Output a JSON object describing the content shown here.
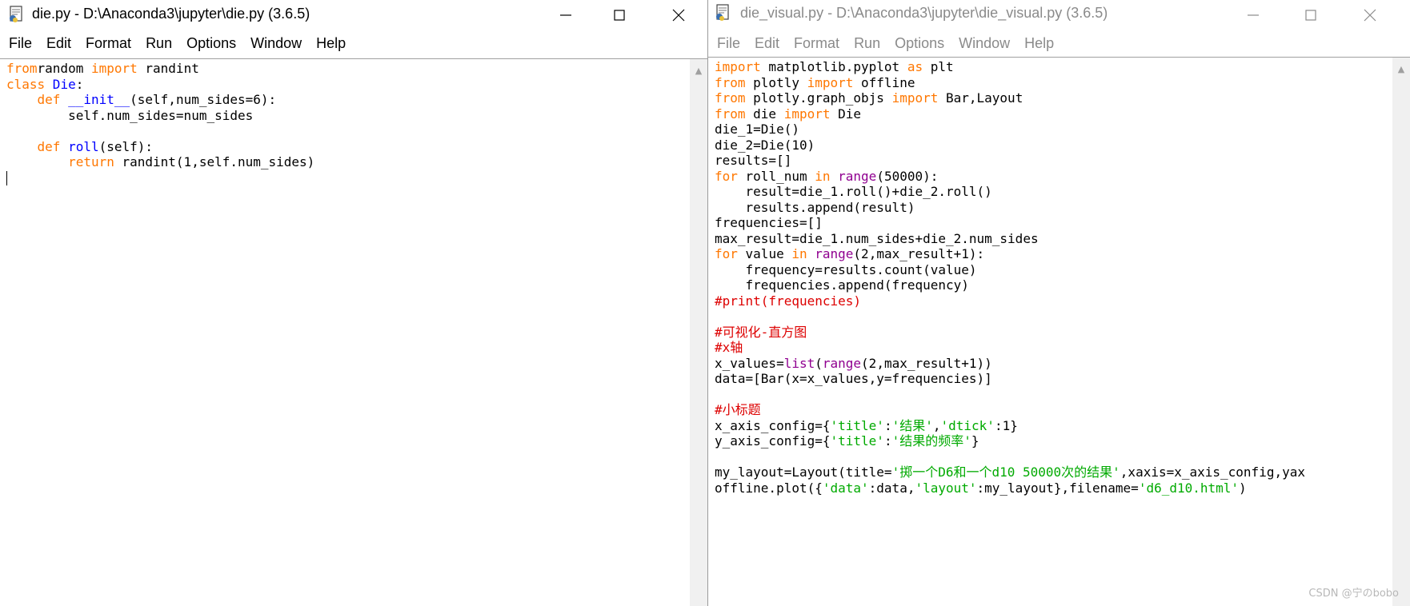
{
  "left_window": {
    "title": "die.py - D:\\Anaconda3\\jupyter\\die.py (3.6.5)",
    "menu": [
      "File",
      "Edit",
      "Format",
      "Run",
      "Options",
      "Window",
      "Help"
    ],
    "code": [
      [
        [
          "kw",
          "from"
        ],
        [
          "",
          "random "
        ],
        [
          "kw",
          "import"
        ],
        [
          "",
          " randint"
        ]
      ],
      [
        [
          "kw",
          "class"
        ],
        [
          "",
          ""
        ],
        [
          "df",
          " Die"
        ],
        [
          "",
          ":"
        ]
      ],
      [
        [
          "",
          "    "
        ],
        [
          "kw",
          "def"
        ],
        [
          "",
          " "
        ],
        [
          "df",
          "__init__"
        ],
        [
          "",
          "(self,num_sides=6):"
        ]
      ],
      [
        [
          "",
          "        self.num_sides=num_sides"
        ]
      ],
      [
        [
          "",
          ""
        ]
      ],
      [
        [
          "",
          "    "
        ],
        [
          "kw",
          "def"
        ],
        [
          "",
          " "
        ],
        [
          "df",
          "roll"
        ],
        [
          "",
          "(self):"
        ]
      ],
      [
        [
          "",
          "        "
        ],
        [
          "kw",
          "return"
        ],
        [
          "",
          " randint(1,self.num_sides)"
        ]
      ],
      [
        [
          "",
          ""
        ]
      ]
    ]
  },
  "right_window": {
    "title": "die_visual.py - D:\\Anaconda3\\jupyter\\die_visual.py (3.6.5)",
    "menu": [
      "File",
      "Edit",
      "Format",
      "Run",
      "Options",
      "Window",
      "Help"
    ],
    "code": [
      [
        [
          "kw",
          "import"
        ],
        [
          "",
          " matplotlib.pyplot "
        ],
        [
          "kw",
          "as"
        ],
        [
          "",
          " plt"
        ]
      ],
      [
        [
          "kw",
          "from"
        ],
        [
          "",
          " plotly "
        ],
        [
          "kw",
          "import"
        ],
        [
          "",
          " offline"
        ]
      ],
      [
        [
          "kw",
          "from"
        ],
        [
          "",
          " plotly.graph_objs "
        ],
        [
          "kw",
          "import"
        ],
        [
          "",
          " Bar,Layout"
        ]
      ],
      [
        [
          "kw",
          "from"
        ],
        [
          "",
          " die "
        ],
        [
          "kw",
          "import"
        ],
        [
          "",
          " Die"
        ]
      ],
      [
        [
          "",
          "die_1=Die()"
        ]
      ],
      [
        [
          "",
          "die_2=Die(10)"
        ]
      ],
      [
        [
          "",
          "results=[]"
        ]
      ],
      [
        [
          "kw",
          "for"
        ],
        [
          "",
          " roll_num "
        ],
        [
          "kw",
          "in"
        ],
        [
          "",
          " "
        ],
        [
          "bi",
          "range"
        ],
        [
          "",
          "(50000):"
        ]
      ],
      [
        [
          "",
          "    result=die_1.roll()+die_2.roll()"
        ]
      ],
      [
        [
          "",
          "    results.append(result)"
        ]
      ],
      [
        [
          "",
          "frequencies=[]"
        ]
      ],
      [
        [
          "",
          "max_result=die_1.num_sides+die_2.num_sides"
        ]
      ],
      [
        [
          "kw",
          "for"
        ],
        [
          "",
          " value "
        ],
        [
          "kw",
          "in"
        ],
        [
          "",
          " "
        ],
        [
          "bi",
          "range"
        ],
        [
          "",
          "(2,max_result+1):"
        ]
      ],
      [
        [
          "",
          "    frequency=results.count(value)"
        ]
      ],
      [
        [
          "",
          "    frequencies.append(frequency)"
        ]
      ],
      [
        [
          "cm",
          "#print(frequencies)"
        ]
      ],
      [
        [
          "",
          ""
        ]
      ],
      [
        [
          "cm",
          "#可视化-直方图"
        ]
      ],
      [
        [
          "cm",
          "#x轴"
        ]
      ],
      [
        [
          "",
          "x_values="
        ],
        [
          "bi",
          "list"
        ],
        [
          "",
          "("
        ],
        [
          "bi",
          "range"
        ],
        [
          "",
          "(2,max_result+1))"
        ]
      ],
      [
        [
          "",
          "data=[Bar(x=x_values,y=frequencies)]"
        ]
      ],
      [
        [
          "",
          ""
        ]
      ],
      [
        [
          "cm",
          "#小标题"
        ]
      ],
      [
        [
          "",
          "x_axis_config={"
        ],
        [
          "str",
          "'title'"
        ],
        [
          "",
          ":"
        ],
        [
          "str",
          "'结果'"
        ],
        [
          "",
          ","
        ],
        [
          "str",
          "'dtick'"
        ],
        [
          "",
          ":1}"
        ]
      ],
      [
        [
          "",
          "y_axis_config={"
        ],
        [
          "str",
          "'title'"
        ],
        [
          "",
          ":"
        ],
        [
          "str",
          "'结果的频率'"
        ],
        [
          "",
          "}"
        ]
      ],
      [
        [
          "",
          ""
        ]
      ],
      [
        [
          "",
          "my_layout=Layout(title="
        ],
        [
          "str",
          "'掷一个D6和一个d10 50000次的结果'"
        ],
        [
          "",
          ",xaxis=x_axis_config,yax"
        ]
      ],
      [
        [
          "",
          "offline.plot({"
        ],
        [
          "str",
          "'data'"
        ],
        [
          "",
          ":data,"
        ],
        [
          "str",
          "'layout'"
        ],
        [
          "",
          ":my_layout},filename="
        ],
        [
          "str",
          "'d6_d10.html'"
        ],
        [
          "",
          ")"
        ]
      ]
    ]
  },
  "watermark": "CSDN @宁のbobo",
  "colors": {
    "keyword": "#ff7700",
    "builtin": "#900090",
    "definition": "#0000ff",
    "string": "#00aa00",
    "comment": "#dd0000"
  }
}
